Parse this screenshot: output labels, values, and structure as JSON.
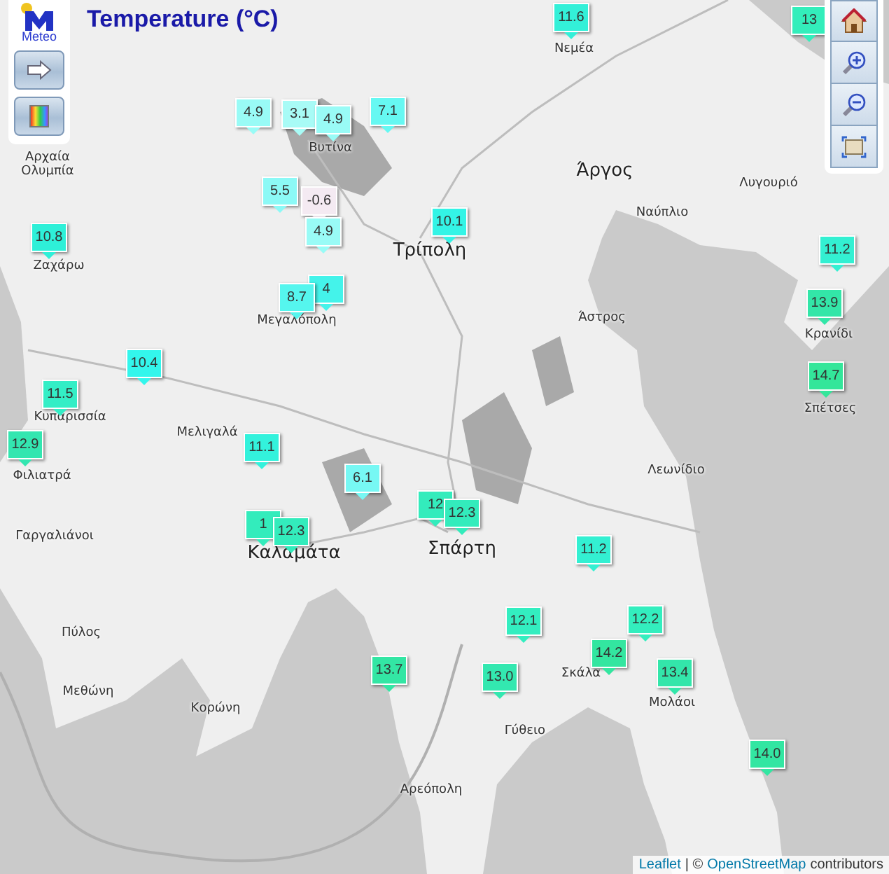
{
  "title": "Temperature (°C)",
  "logo": {
    "text": "Meteo"
  },
  "left_controls": [
    {
      "kind": "arrow"
    },
    {
      "kind": "palette"
    }
  ],
  "right_controls": [
    {
      "kind": "home"
    },
    {
      "kind": "zoom-in"
    },
    {
      "kind": "zoom-out"
    },
    {
      "kind": "fullscreen"
    }
  ],
  "places": [
    {
      "name": "Νεμέα",
      "kind": "town"
    },
    {
      "name": "Βυτίνα",
      "kind": "town"
    },
    {
      "name": "Αρχαία Ολυμπία",
      "kind": "town"
    },
    {
      "name": "Άργος",
      "kind": "city"
    },
    {
      "name": "Λυγουριό",
      "kind": "town"
    },
    {
      "name": "Ναύπλιο",
      "kind": "town"
    },
    {
      "name": "Τρίπολη",
      "kind": "city"
    },
    {
      "name": "Ζαχάρω",
      "kind": "town"
    },
    {
      "name": "Μεγαλόπολη",
      "kind": "town"
    },
    {
      "name": "Άστρος",
      "kind": "town"
    },
    {
      "name": "Κρανίδι",
      "kind": "town"
    },
    {
      "name": "Σπέτσες",
      "kind": "town"
    },
    {
      "name": "Κυπαρισσία",
      "kind": "town"
    },
    {
      "name": "Μελιγαλά",
      "kind": "town"
    },
    {
      "name": "Λεωνίδιο",
      "kind": "town"
    },
    {
      "name": "Φιλιατρά",
      "kind": "town"
    },
    {
      "name": "Σπάρτη",
      "kind": "city"
    },
    {
      "name": "Γαργαλιάνοι",
      "kind": "town"
    },
    {
      "name": "Καλαμάτα",
      "kind": "city"
    },
    {
      "name": "Πύλος",
      "kind": "town"
    },
    {
      "name": "Σκάλα",
      "kind": "town"
    },
    {
      "name": "Μεθώνη",
      "kind": "town"
    },
    {
      "name": "Μολάοι",
      "kind": "town"
    },
    {
      "name": "Κορώνη",
      "kind": "town"
    },
    {
      "name": "Γύθειο",
      "kind": "town"
    },
    {
      "name": "Αρεόπολη",
      "kind": "town"
    }
  ],
  "markers": [
    {
      "value": "11.6",
      "color": "#33f0d8"
    },
    {
      "value": "13",
      "color": "#33eebb"
    },
    {
      "value": "4.9",
      "color": "#99fbf6"
    },
    {
      "value": "3.1",
      "color": "#a8fbf6"
    },
    {
      "value": "4.9",
      "color": "#99fbf6"
    },
    {
      "value": "7.1",
      "color": "#66f8f2"
    },
    {
      "value": "5.5",
      "color": "#8cf9f6"
    },
    {
      "value": "-0.6",
      "color": "#f4eaf2"
    },
    {
      "value": "4.9",
      "color": "#99fbf6"
    },
    {
      "value": "10.1",
      "color": "#33f4e6"
    },
    {
      "value": "10.8",
      "color": "#2ef0d8"
    },
    {
      "value": "11.2",
      "color": "#33f0d2"
    },
    {
      "value": "4",
      "color": "#44f3ea"
    },
    {
      "value": "8.7",
      "color": "#55f6ee"
    },
    {
      "value": "13.9",
      "color": "#33e6a8"
    },
    {
      "value": "10.4",
      "color": "#33f6ec"
    },
    {
      "value": "11.5",
      "color": "#33eec6"
    },
    {
      "value": "14.7",
      "color": "#33e69a"
    },
    {
      "value": "12.9",
      "color": "#33e6b0"
    },
    {
      "value": "11.1",
      "color": "#33f2dc"
    },
    {
      "value": "6.1",
      "color": "#77f8f4"
    },
    {
      "value": "12",
      "color": "#33ecbc"
    },
    {
      "value": "12.3",
      "color": "#33ecbc"
    },
    {
      "value": "1",
      "color": "#33ecbc"
    },
    {
      "value": "12.3",
      "color": "#33ecbc"
    },
    {
      "value": "11.2",
      "color": "#33f0d2"
    },
    {
      "value": "12.1",
      "color": "#33eec0"
    },
    {
      "value": "12.2",
      "color": "#33eebe"
    },
    {
      "value": "14.2",
      "color": "#33e6a0"
    },
    {
      "value": "13.7",
      "color": "#33e6a4"
    },
    {
      "value": "13.4",
      "color": "#33e6aa"
    },
    {
      "value": "13.0",
      "color": "#33e8b0"
    },
    {
      "value": "14.0",
      "color": "#33e6a2"
    }
  ],
  "attribution": {
    "link_1": "Leaflet",
    "separator": "| ©",
    "link_2": "OpenStreetMap",
    "text": "contributors"
  }
}
